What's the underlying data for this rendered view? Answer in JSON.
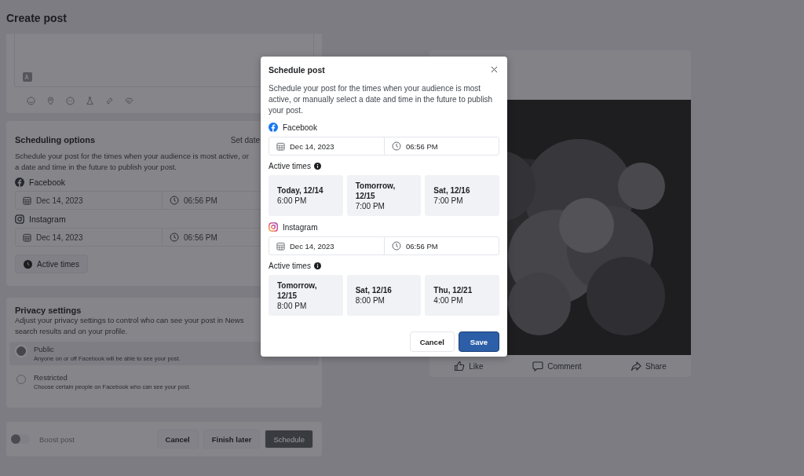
{
  "page": {
    "title": "Create post"
  },
  "scheduling": {
    "title": "Scheduling options",
    "action": "Set date",
    "description_lines": [
      "Schedule your post for the times when your audience is most active, or",
      "a date and time in the future to publish your post."
    ],
    "platforms": [
      {
        "kind": "facebook",
        "name": "Facebook",
        "date": "Dec 14, 2023",
        "time": "06:56 PM"
      },
      {
        "kind": "instagram",
        "name": "Instagram",
        "date": "Dec 14, 2023",
        "time": "06:56 PM"
      }
    ],
    "active_times_button": "Active times"
  },
  "privacy": {
    "title": "Privacy settings",
    "description_lines": [
      "Adjust your privacy settings to control who can see your post in News",
      "search results and on your profile."
    ],
    "options": [
      {
        "label": "Public",
        "description": "Anyone on or off Facebook will be able to see your post.",
        "selected": true
      },
      {
        "label": "Restricted",
        "description": "Choose certain people on Facebook who can see your post.",
        "selected": false
      }
    ]
  },
  "footer": {
    "boost": {
      "label": "Boost post",
      "on": false
    },
    "buttons": [
      {
        "label": "Cancel",
        "disabled": false
      },
      {
        "label": "Finish later",
        "disabled": false
      },
      {
        "label": "Schedule",
        "disabled": true
      }
    ]
  },
  "preview": {
    "actions": [
      {
        "kind": "like",
        "label": "Like"
      },
      {
        "kind": "comment",
        "label": "Comment"
      },
      {
        "kind": "share",
        "label": "Share"
      }
    ]
  },
  "modal": {
    "title": "Schedule post",
    "description": "Schedule your post for the times when your audience is most active, or manually select a date and time in the future to publish your post.",
    "platforms": [
      {
        "kind": "facebook",
        "name": "Facebook",
        "date": "Dec 14, 2023",
        "time": "06:56 PM",
        "active_times_label": "Active times",
        "slots": [
          {
            "day": "Today, 12/14",
            "time": "6:00 PM"
          },
          {
            "day": "Tomorrow, 12/15",
            "time": "7:00 PM"
          },
          {
            "day": "Sat, 12/16",
            "time": "7:00 PM"
          }
        ]
      },
      {
        "kind": "instagram",
        "name": "Instagram",
        "date": "Dec 14, 2023",
        "time": "06:56 PM",
        "active_times_label": "Active times",
        "slots": [
          {
            "day": "Tomorrow, 12/15",
            "time": "8:00 PM"
          },
          {
            "day": "Sat, 12/16",
            "time": "8:00 PM"
          },
          {
            "day": "Thu, 12/21",
            "time": "4:00 PM"
          }
        ]
      }
    ],
    "buttons": [
      {
        "label": "Cancel",
        "kind": "secondary"
      },
      {
        "label": "Save",
        "kind": "primary"
      }
    ]
  }
}
